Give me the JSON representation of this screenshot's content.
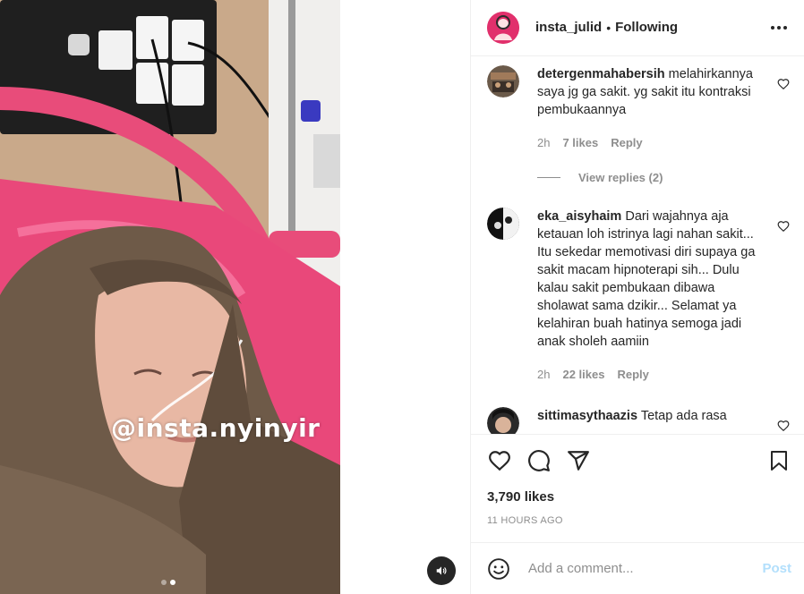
{
  "header": {
    "username": "insta_julid",
    "separator": "•",
    "follow_status": "Following",
    "avatar_color": "#e1306c"
  },
  "media": {
    "watermark": "@insta.nyinyir",
    "carousel_count": 2,
    "carousel_active": 2
  },
  "comments": [
    {
      "username": "detergenmahabersih",
      "text": "melahirkannya saya jg ga sakit. yg sakit itu kontraksi pembukaannya",
      "time": "2h",
      "likes": "7 likes",
      "reply_label": "Reply",
      "view_replies": "View replies (2)"
    },
    {
      "username": "eka_aisyhaim",
      "text": "Dari wajahnya aja ketauan loh istrinya lagi nahan sakit... Itu sekedar memotivasi diri supaya ga sakit macam hipnoterapi sih... Dulu kalau sakit pembukaan dibawa sholawat sama dzikir... Selamat ya kelahiran buah hatinya semoga jadi anak sholeh aamiin",
      "time": "2h",
      "likes": "22 likes",
      "reply_label": "Reply"
    },
    {
      "username": "sittimasythaazis",
      "text": "Tetap ada rasa"
    }
  ],
  "stats": {
    "likes": "3,790 likes",
    "time_ago": "11 HOURS AGO"
  },
  "composer": {
    "placeholder": "Add a comment...",
    "post_label": "Post"
  },
  "icons": {
    "like": "heart-icon",
    "comment": "comment-icon",
    "share": "share-icon",
    "save": "bookmark-icon",
    "more": "more-icon",
    "emoji": "emoji-icon",
    "mute": "speaker-icon"
  }
}
